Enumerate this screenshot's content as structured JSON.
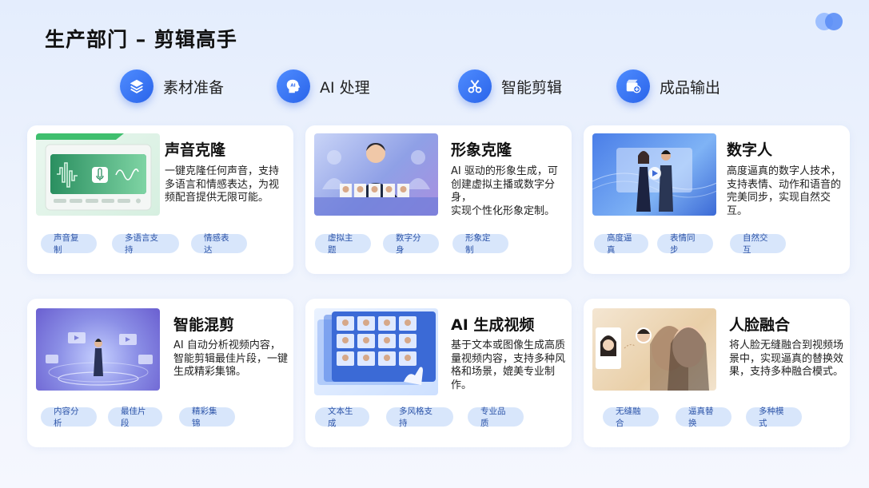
{
  "header": {
    "title": "生产部门 – 剪辑高手"
  },
  "logo": {
    "icon": "overlapping-circles-logo",
    "colors": [
      "#9ec0ff",
      "#5b8ef6"
    ]
  },
  "steps": [
    {
      "label": "素材准备",
      "icon": "layers-icon"
    },
    {
      "label": "AI 处理",
      "icon": "ai-head-icon"
    },
    {
      "label": "智能剪辑",
      "icon": "scissors-icon"
    },
    {
      "label": "成品输出",
      "icon": "export-video-icon"
    }
  ],
  "cards": [
    {
      "title": "声音克隆",
      "desc": [
        "一键克隆任何声音，支持",
        "多语言和情感表达，为视",
        "频配音提供无限可能。"
      ],
      "tags": [
        "声音复制",
        "多语言支持",
        "情感表达"
      ],
      "image": "voice-clone-app-screenshot"
    },
    {
      "title": "形象克隆",
      "desc": [
        "AI 驱动的形象生成，可",
        "创建虚拟主播或数字分身，",
        "实现个性化形象定制。"
      ],
      "tags": [
        "虚拟主题",
        "数字分身",
        "形象定制"
      ],
      "image": "digital-avatar-portrait"
    },
    {
      "title": "数字人",
      "desc": [
        "高度逼真的数字人技术，",
        "支持表情、动作和语音的",
        "完美同步，实现自然交互。"
      ],
      "tags": [
        "高度逼真",
        "表情同步",
        "自然交互"
      ],
      "image": "digital-humans-screen"
    },
    {
      "title": "智能混剪",
      "desc": [
        "AI 自动分析视频内容，",
        "智能剪辑最佳片段，一键",
        "生成精彩集锦。"
      ],
      "tags": [
        "内容分析",
        "最佳片段",
        "精彩集锦"
      ],
      "image": "smart-editing-hologram"
    },
    {
      "title": "AI 生成视频",
      "desc": [
        "基于文本或图像生成高质",
        "量视频内容，支持多种风",
        "格和场景，媲美专业制作。"
      ],
      "tags": [
        "文本生成",
        "多风格支持",
        "专业品质"
      ],
      "image": "video-grid-screens"
    },
    {
      "title": "人脸融合",
      "desc": [
        "将人脸无缝融合到视频场",
        "景中，实现逼真的替换效",
        "果，支持多种融合模式。"
      ],
      "tags": [
        "无缝融合",
        "逼真替换",
        "多种模式"
      ],
      "image": "face-fusion-portraits"
    }
  ],
  "colors": {
    "accent": "#2f6bf0",
    "tag_bg": "#d8e6fb",
    "tag_text": "#2d54a8",
    "page_bg": "#e9f0fd"
  }
}
